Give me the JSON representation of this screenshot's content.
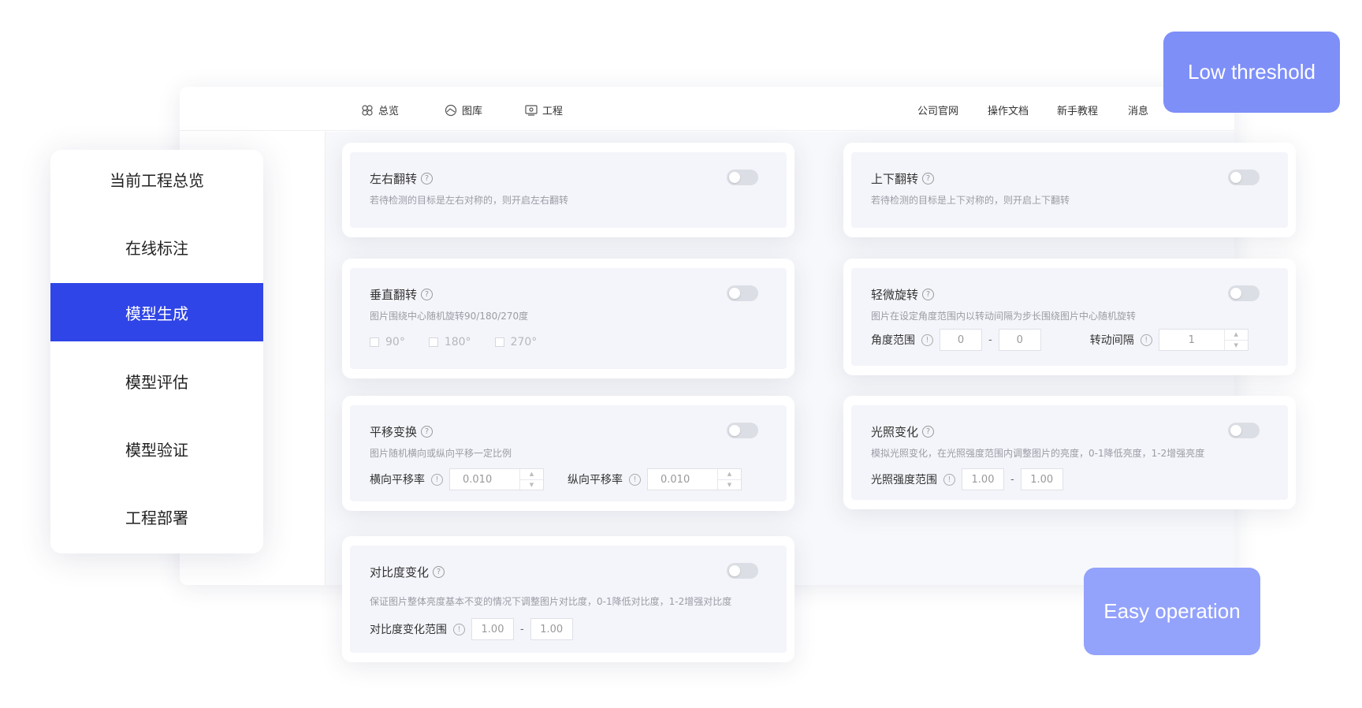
{
  "nav": {
    "items": [
      {
        "label": "总览",
        "icon": "clover-icon"
      },
      {
        "label": "图库",
        "icon": "gallery-icon"
      },
      {
        "label": "工程",
        "icon": "monitor-icon"
      }
    ],
    "links": [
      "公司官网",
      "操作文档",
      "新手教程",
      "消息"
    ]
  },
  "menu": {
    "items": [
      "当前工程总览",
      "在线标注",
      "模型生成",
      "模型评估",
      "模型验证",
      "工程部署"
    ],
    "active": "模型生成",
    "accent": "#2f45e7"
  },
  "cards": {
    "flip_lr": {
      "title": "左右翻转",
      "desc": "若待检测的目标是左右对称的，则开启左右翻转"
    },
    "flip_ud": {
      "title": "上下翻转",
      "desc": "若待检测的目标是上下对称的，则开启上下翻转"
    },
    "flip_v": {
      "title": "垂直翻转",
      "desc": "图片围绕中心随机旋转90/180/270度",
      "options": [
        "90°",
        "180°",
        "270°"
      ]
    },
    "rotate": {
      "title": "轻微旋转",
      "desc": "图片在设定角度范围内以转动间隔为步长围绕图片中心随机旋转",
      "angle_label": "角度范围",
      "angle_min": "0",
      "angle_max": "0",
      "step_label": "转动间隔",
      "step_value": "1"
    },
    "translate": {
      "title": "平移变换",
      "desc": "图片随机横向或纵向平移一定比例",
      "h_label": "横向平移率",
      "h_value": "0.010",
      "v_label": "纵向平移率",
      "v_value": "0.010"
    },
    "light": {
      "title": "光照变化",
      "desc": "模拟光照变化，在光照强度范围内调整图片的亮度，0-1降低亮度，1-2增强亮度",
      "range_label": "光照强度范围",
      "min": "1.00",
      "max": "1.00"
    },
    "contrast": {
      "title": "对比度变化",
      "desc": "保证图片整体亮度基本不变的情况下调整图片对比度，0-1降低对比度，1-2增强对比度",
      "range_label": "对比度变化范围",
      "min": "1.00",
      "max": "1.00"
    }
  },
  "badges": {
    "low_threshold": "Low threshold",
    "easy_operation": "Easy operation",
    "color_top": "#7e8ff8",
    "color_bottom": "#93a2fb"
  }
}
